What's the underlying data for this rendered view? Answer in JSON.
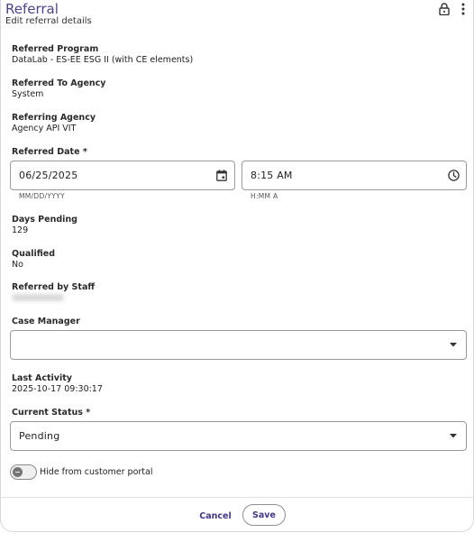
{
  "header": {
    "title": "Referral",
    "subtitle": "Edit referral details"
  },
  "fields": {
    "referred_program": {
      "label": "Referred Program",
      "value": "DataLab - ES-EE ESG II (with CE elements)"
    },
    "referred_to_agency": {
      "label": "Referred To Agency",
      "value": "System"
    },
    "referring_agency": {
      "label": "Referring Agency",
      "value": "Agency API VIT"
    },
    "referred_date": {
      "label": "Referred Date *",
      "date_value": "06/25/2025",
      "date_helper": "MM/DD/YYYY",
      "time_value": "8:15 AM",
      "time_helper": "H:MM A"
    },
    "days_pending": {
      "label": "Days Pending",
      "value": "129"
    },
    "qualified": {
      "label": "Qualified",
      "value": "No"
    },
    "referred_by_staff": {
      "label": "Referred by Staff"
    },
    "case_manager": {
      "label": "Case Manager",
      "value": ""
    },
    "last_activity": {
      "label": "Last Activity",
      "value": "2025-10-17 09:30:17"
    },
    "current_status": {
      "label": "Current Status *",
      "value": "Pending"
    }
  },
  "toggle": {
    "label": "Hide from customer portal",
    "checked": false
  },
  "footer": {
    "cancel_label": "Cancel",
    "save_label": "Save"
  },
  "icons": {
    "lock": "lock-icon",
    "more": "more-vertical-icon",
    "calendar": "calendar-icon",
    "clock": "clock-icon",
    "dropdown": "chevron-down-icon"
  },
  "colors": {
    "accent": "#4a4590",
    "button_text": "#3e3a87"
  }
}
